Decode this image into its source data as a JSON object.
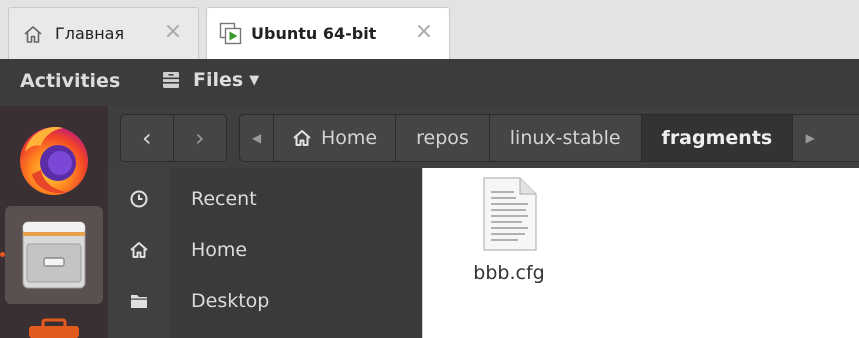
{
  "host_tabs": [
    {
      "label": "Главная",
      "icon": "home-icon",
      "active": false
    },
    {
      "label": "Ubuntu 64-bit",
      "icon": "vm-icon",
      "active": true
    }
  ],
  "topbar": {
    "activities": "Activities",
    "app_menu": "Files"
  },
  "dock": {
    "items": [
      "firefox-icon",
      "files-icon",
      "app-icon"
    ]
  },
  "nav": {
    "back": "‹",
    "forward": "›"
  },
  "pathbar": {
    "home": "Home",
    "crumbs": [
      "repos",
      "linux-stable"
    ],
    "current": "fragments"
  },
  "sidebar": {
    "items": [
      {
        "label": "Recent",
        "icon": "clock-icon"
      },
      {
        "label": "Home",
        "icon": "home-icon"
      },
      {
        "label": "Desktop",
        "icon": "folder-icon"
      }
    ]
  },
  "content": {
    "files": [
      {
        "name": "bbb.cfg",
        "icon": "text-file-icon"
      }
    ]
  },
  "colors": {
    "accent": "#e95420",
    "topbar": "#3c3c3c",
    "dock": "#3a2f33"
  }
}
